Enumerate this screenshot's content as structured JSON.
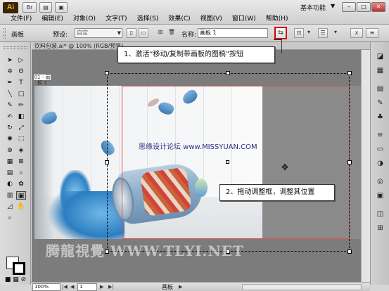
{
  "app": {
    "logo": "Ai"
  },
  "menu": [
    "文件(F)",
    "编辑(E)",
    "对象(O)",
    "文字(T)",
    "选择(S)",
    "效果(C)",
    "视图(V)",
    "窗口(W)",
    "帮助(H)"
  ],
  "workspace": "基本功能",
  "control_bar": {
    "artboard_label": "画板",
    "preset_label": "预设:",
    "preset_value": "自定",
    "name_label": "名称:",
    "name_value": "画板 1"
  },
  "document": {
    "tab_title": "饮料包装.ai* @ 100% (RGB/预览)",
    "artboard_tag": "01 - 画板 1"
  },
  "callouts": {
    "step1": "1、激活“移动/复制带画板的图稿”按钮",
    "step2": "2、拖动调整框，调整其位置"
  },
  "watermarks": {
    "center": "思缘设计论坛 www.MISSYUAN.COM",
    "bottom": "腾龍視覺 WWW.TLYI.NET"
  },
  "status_bar": {
    "zoom": "100%",
    "page": "1",
    "label": "画板"
  },
  "icons": [
    "move-copy-artwork-icon",
    "selection-icon",
    "direct-selection-icon",
    "pen-icon",
    "type-icon",
    "brush-icon",
    "crosshair-move-icon",
    "color-panel-icon",
    "swatch-icon"
  ]
}
